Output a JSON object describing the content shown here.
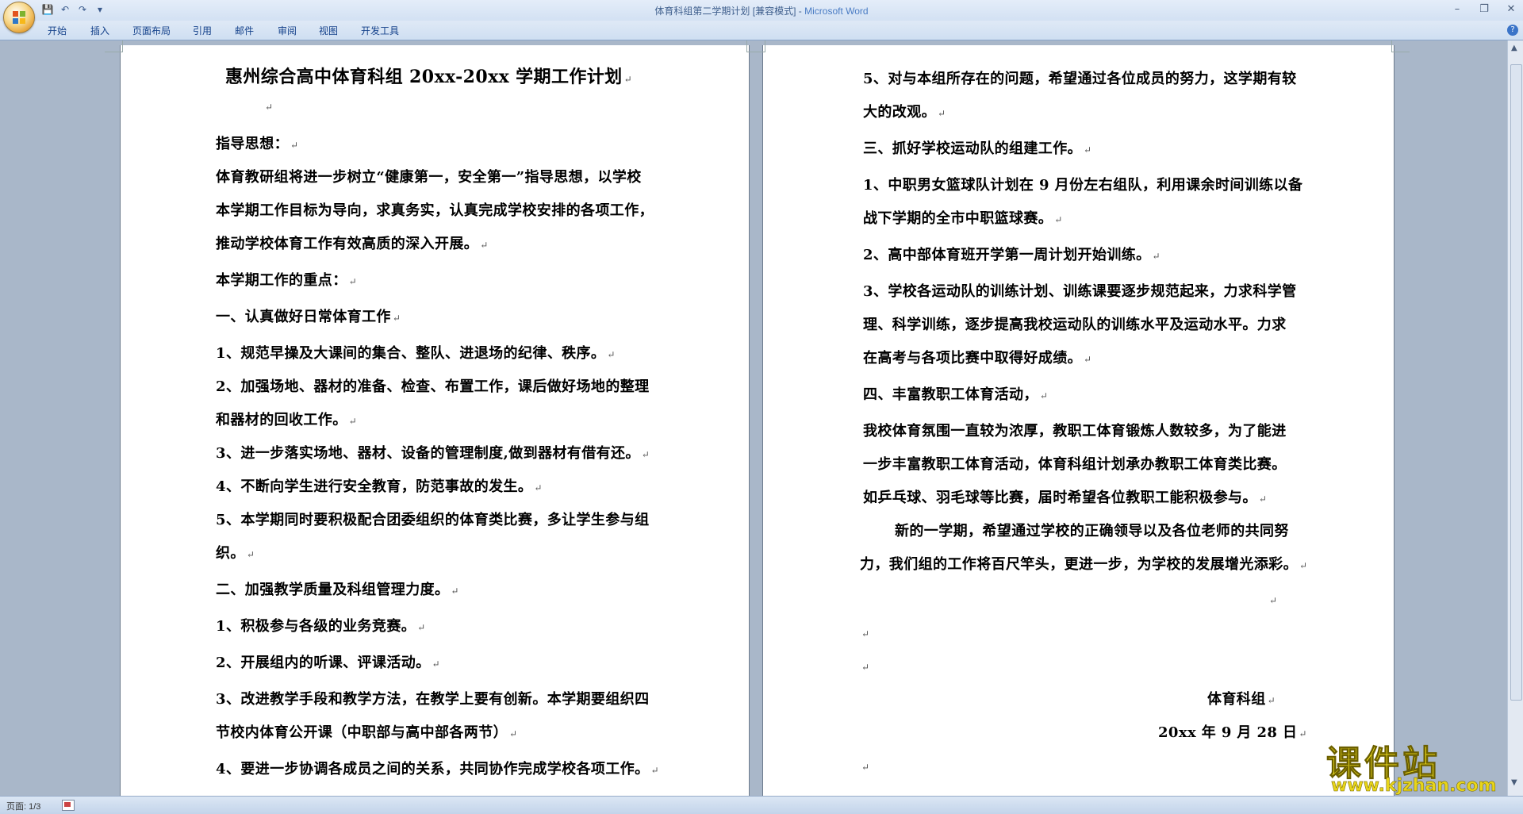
{
  "window": {
    "title": "体育科组第二学期计划 [兼容模式]",
    "app": "Microsoft Word"
  },
  "qat": {
    "save_icon": "save-icon",
    "undo_icon": "undo-icon",
    "redo_icon": "redo-icon"
  },
  "tabs": [
    "开始",
    "插入",
    "页面布局",
    "引用",
    "邮件",
    "审阅",
    "视图",
    "开发工具"
  ],
  "status": {
    "page": "页面: 1/3"
  },
  "document": {
    "page1": [
      "惠州综合高中体育科组 20xx-20xx 学期工作计划",
      "",
      "指导思想：",
      "体育教研组将进一步树立“健康第一，安全第一”指导思想，以学校",
      "本学期工作目标为导向，求真务实，认真完成学校安排的各项工作，",
      "推动学校体育工作有效高质的深入开展。",
      " 本学期工作的重点：",
      " 一、认真做好日常体育工作",
      "1、规范早操及大课间的集合、整队、进退场的纪律、秩序。",
      "2、加强场地、器材的准备、检查、布置工作，课后做好场地的整理",
      "和器材的回收工作。",
      "3、进一步落实场地、器材、设备的管理制度,做到器材有借有还。",
      "4、不断向学生进行安全教育，防范事故的发生。",
      "5、本学期同时要积极配合团委组织的体育类比赛，多让学生参与组",
      "织。",
      " 二、加强教学质量及科组管理力度。",
      " 1、积极参与各级的业务竞赛。",
      " 2、开展组内的听课、评课活动。",
      " 3、改进教学手段和教学方法，在教学上要有创新。本学期要组织四",
      " 节校内体育公开课（中职部与高中部各两节）",
      " 4、要进一步协调各成员之间的关系，共同协作完成学校各项工作。"
    ],
    "page2": [
      "5、对与本组所存在的问题，希望通过各位成员的努力，这学期有较",
      "大的改观。",
      "三、抓好学校运动队的组建工作。",
      "1、中职男女篮球队计划在 9 月份左右组队，利用课余时间训练以备",
      "战下学期的全市中职篮球赛。",
      "2、高中部体育班开学第一周计划开始训练。",
      "3、学校各运动队的训练计划、训练课要逐步规范起来，力求科学管",
      "理、科学训练，逐步提高我校运动队的训练水平及运动水平。力求",
      "在高考与各项比赛中取得好成绩。",
      "四、丰富教职工体育活动，",
      "我校体育氛围一直较为浓厚，教职工体育锻炼人数较多，为了能进",
      "一步丰富教职工体育活动，体育科组计划承办教职工体育类比赛。",
      "如乒乓球、羽毛球等比赛，届时希望各位教职工能积极参与。",
      "新的一学期，希望通过学校的正确领导以及各位老师的共同努",
      "力，我们组的工作将百尺竿头，更进一步，为学校的发展增光添彩。",
      "",
      "",
      "",
      "体育科组",
      "20xx 年 9 月 28 日",
      ""
    ]
  },
  "watermark": {
    "title": "课件站",
    "url": "www.kjzhan.com"
  }
}
